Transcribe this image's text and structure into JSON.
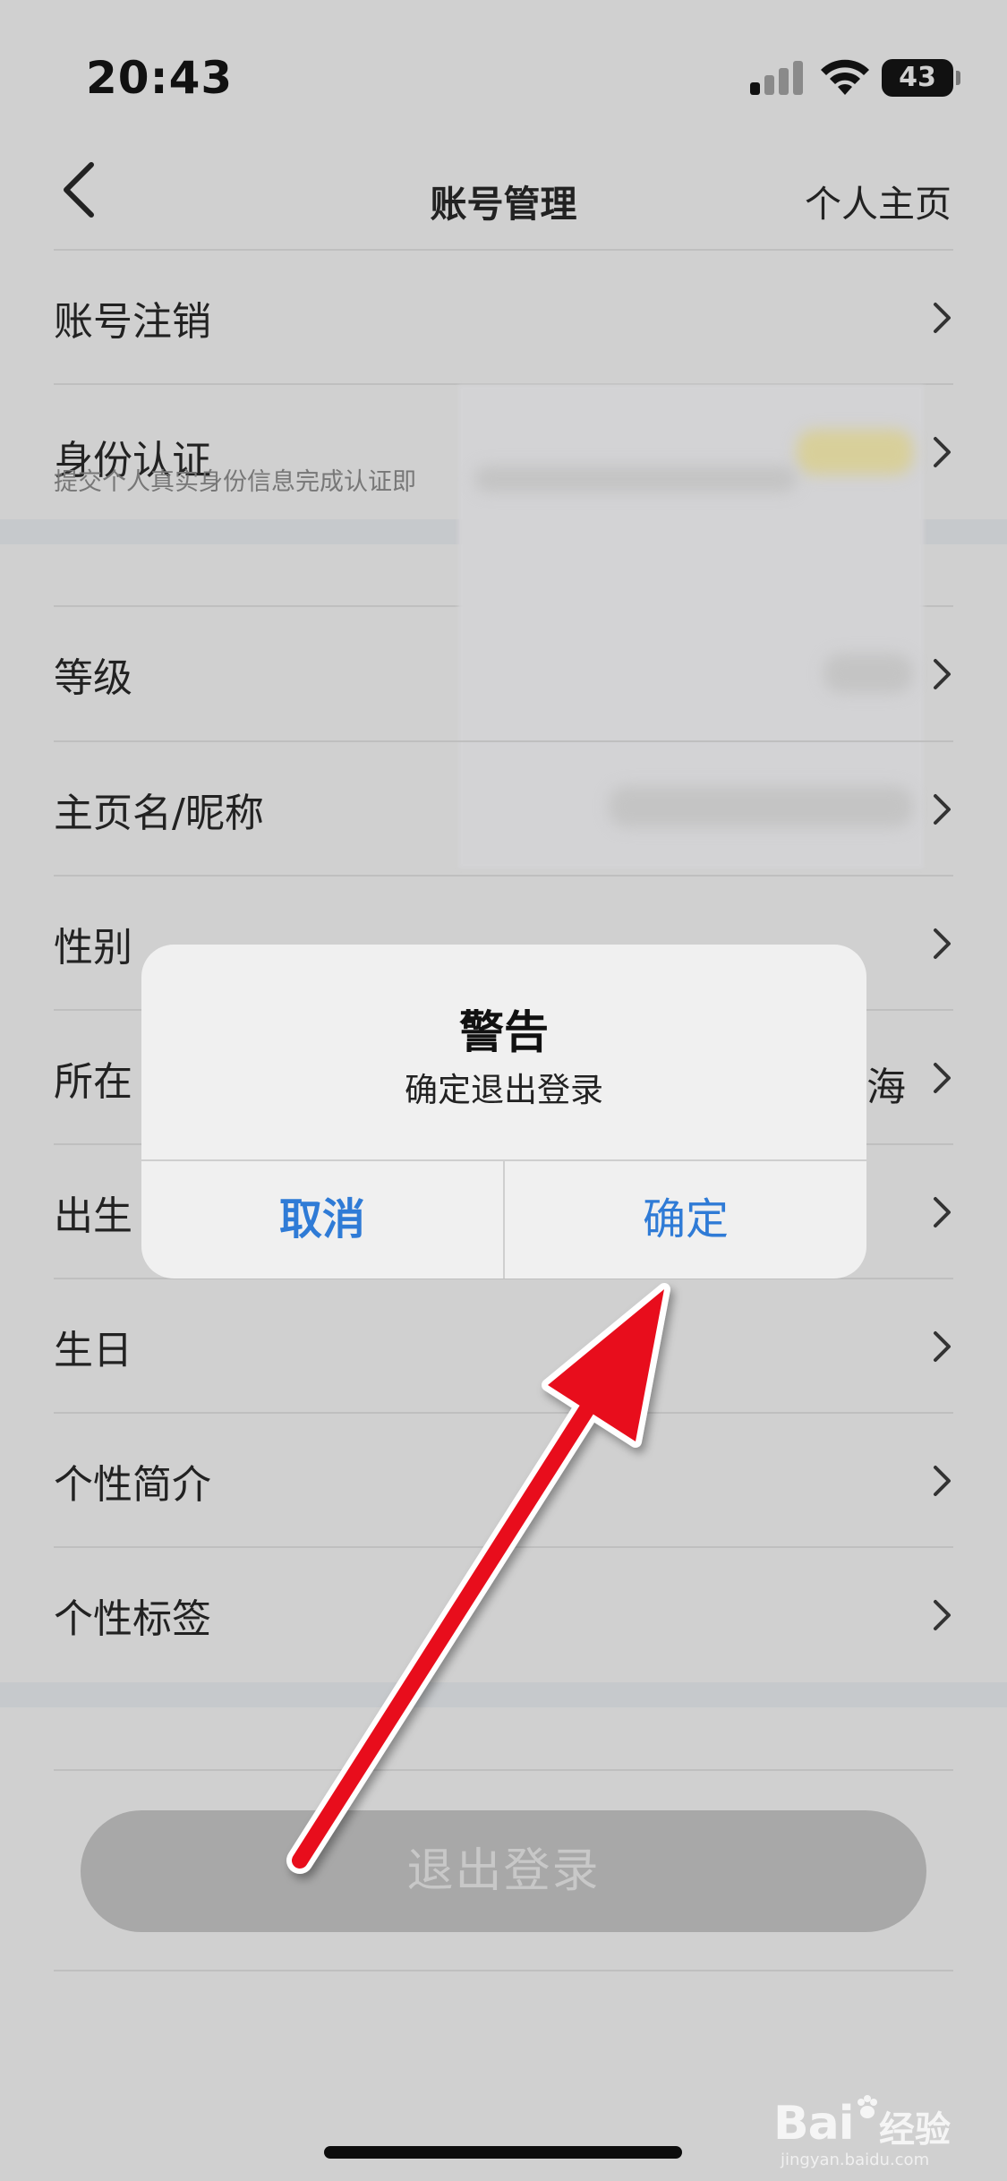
{
  "status_bar": {
    "time": "20:43",
    "battery": "43"
  },
  "nav": {
    "title": "账号管理",
    "right_label": "个人主页"
  },
  "section1": [
    {
      "label": "账号注销"
    },
    {
      "label": "身份认证",
      "subtitle": "提交个人真实身份信息完成认证即"
    }
  ],
  "section2": [
    {
      "label": "等级"
    },
    {
      "label": "主页名/昵称"
    },
    {
      "label": "性别"
    },
    {
      "label": "所在",
      "value": "海"
    },
    {
      "label": "出生"
    },
    {
      "label": "生日"
    },
    {
      "label": "个性简介"
    },
    {
      "label": "个性标签"
    }
  ],
  "logout_button": {
    "label": "退出登录"
  },
  "dialog": {
    "title": "警告",
    "message": "确定退出登录",
    "cancel_label": "取消",
    "ok_label": "确定"
  },
  "watermark": {
    "brand": "Bai",
    "brand_suffix": "经验",
    "site": "jingyan.baidu.com"
  },
  "colors": {
    "accent": "#2f7bd6",
    "arrow": "#e8101e"
  }
}
